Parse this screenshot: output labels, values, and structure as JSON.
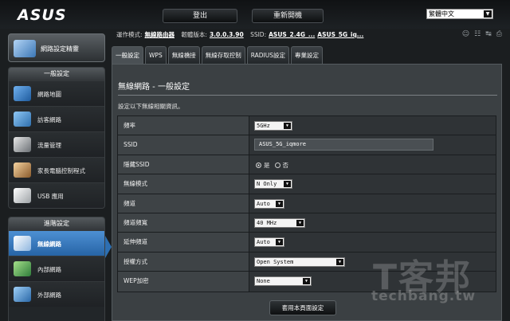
{
  "header": {
    "logo": "ASUS",
    "logout_label": "登出",
    "reboot_label": "重新開機",
    "language": "繁體中文"
  },
  "infobar": {
    "mode_label": "運作模式:",
    "mode_value": "無線路由器",
    "firmware_label": "韌體版本:",
    "firmware_value": "3.0.0.3.90",
    "ssid_label": "SSID:",
    "ssid_24": "ASUS_2.4G_...",
    "ssid_5": "ASUS_5G_iq..."
  },
  "status_icons": [
    "users-icon",
    "network-icon",
    "usb-icon",
    "printer-icon"
  ],
  "sidebar": {
    "quick_setup": "網路設定精靈",
    "general_header": "一般設定",
    "general_items": [
      {
        "label": "網路地圖",
        "icon": "network-map-icon"
      },
      {
        "label": "訪客網路",
        "icon": "guest-network-icon"
      },
      {
        "label": "流量管理",
        "icon": "traffic-manager-icon"
      },
      {
        "label": "家長電腦控制程式",
        "icon": "parental-control-icon"
      },
      {
        "label": "USB 應用",
        "icon": "usb-application-icon"
      }
    ],
    "advanced_header": "進階設定",
    "advanced_items": [
      {
        "label": "無線網路",
        "icon": "wireless-icon"
      },
      {
        "label": "內部網路",
        "icon": "lan-icon"
      },
      {
        "label": "外部網路",
        "icon": "wan-icon"
      }
    ]
  },
  "tabs": [
    "一般設定",
    "WPS",
    "無線橋接",
    "無線存取控制",
    "RADIUS設定",
    "專業設定"
  ],
  "content": {
    "title": "無線網路 - 一般設定",
    "description": "設定以下無線相關資訊。",
    "fields": {
      "band": {
        "label": "頻率",
        "value": "5GHz"
      },
      "ssid": {
        "label": "SSID",
        "value": "ASUS_5G_iqmore"
      },
      "hide_ssid": {
        "label": "隱藏SSID",
        "yes": "是",
        "no": "否"
      },
      "wireless_mode": {
        "label": "無線模式",
        "value": "N Only"
      },
      "channel": {
        "label": "頻道",
        "value": "Auto"
      },
      "bandwidth": {
        "label": "頻道頻寬",
        "value": "40 MHz"
      },
      "ext_channel": {
        "label": "延伸頻道",
        "value": "Auto"
      },
      "auth_method": {
        "label": "授權方式",
        "value": "Open System"
      },
      "wep": {
        "label": "WEP加密",
        "value": "None"
      }
    },
    "apply_label": "套用本頁面設定"
  },
  "watermark": {
    "main": "T客邦",
    "sub": "techbang.tw"
  }
}
